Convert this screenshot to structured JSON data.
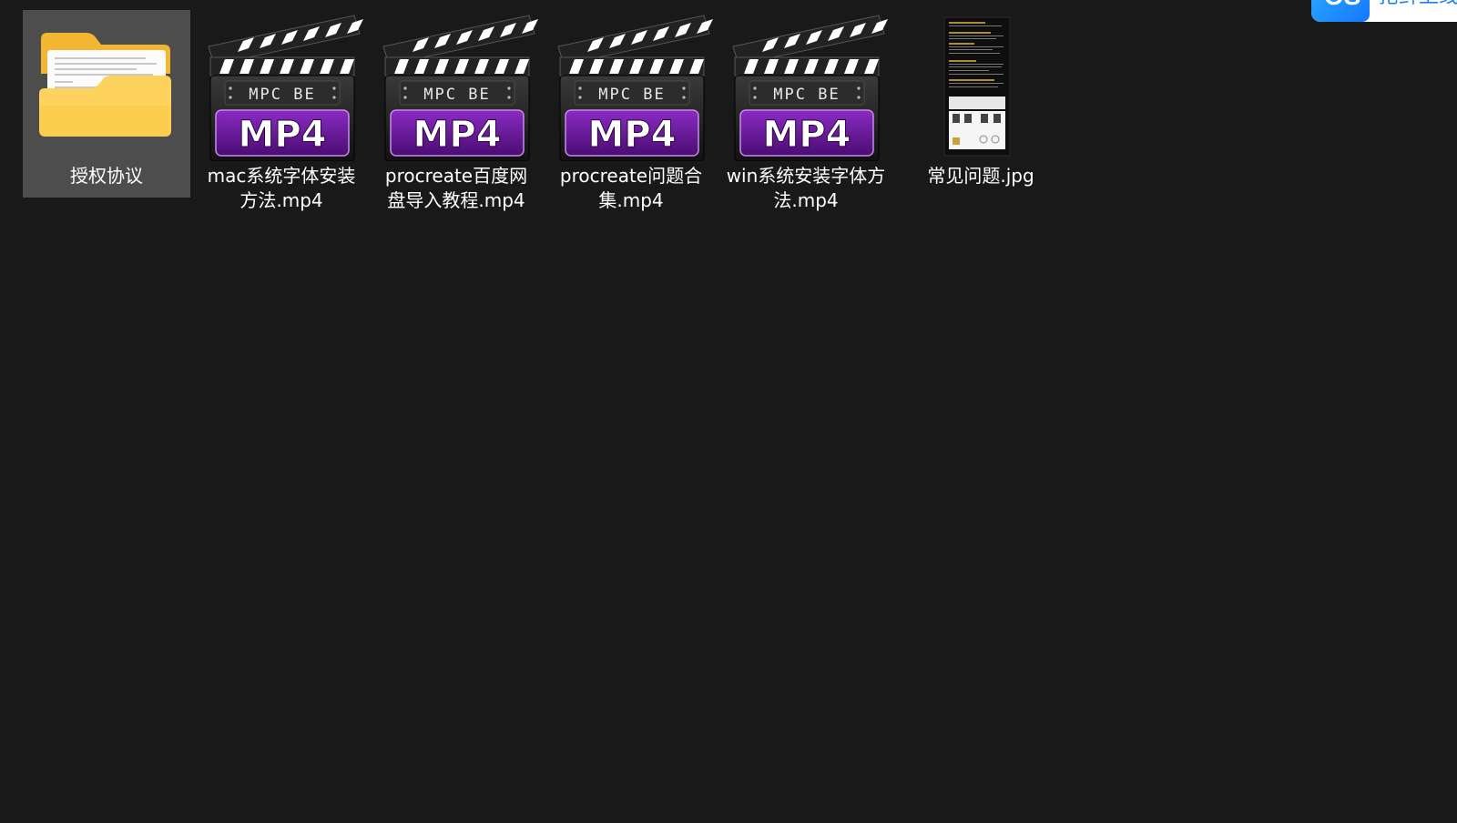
{
  "files": [
    {
      "name": "授权协议",
      "type": "folder",
      "selected": true,
      "icon": "folder-icon"
    },
    {
      "name": "mac系统字体安装方法.mp4",
      "type": "video",
      "icon": "mpc-be-mp4-icon"
    },
    {
      "name": "procreate百度网盘导入教程.mp4",
      "type": "video",
      "icon": "mpc-be-mp4-icon"
    },
    {
      "name": "procreate问题合集.mp4",
      "type": "video",
      "icon": "mpc-be-mp4-icon"
    },
    {
      "name": "win系统安装字体方法.mp4",
      "type": "video",
      "icon": "mpc-be-mp4-icon"
    },
    {
      "name": "常见问题.jpg",
      "type": "image",
      "icon": "image-thumbnail"
    }
  ],
  "video_icon": {
    "brand": "MPC BE",
    "format": "MP4"
  },
  "widget": {
    "logo_text": "OS",
    "text": "抢鲜上线"
  },
  "colors": {
    "background": "#191919",
    "selection": "#4d4d4d",
    "text": "#ffffff",
    "folder_yellow": "#f7c445",
    "mp4_purple": "#6b1a9a",
    "widget_blue": "#1a7cff"
  }
}
